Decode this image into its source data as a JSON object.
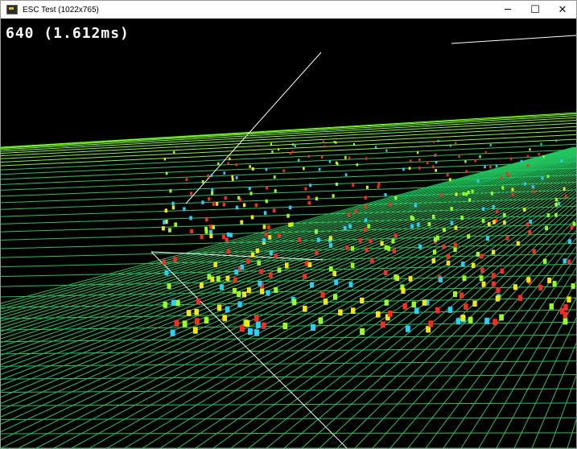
{
  "window": {
    "title": "ESC Test (1022x765)",
    "app_icon": "app-icon",
    "controls": {
      "minimize": "─",
      "maximize": "☐",
      "close": "✕"
    }
  },
  "hud": {
    "text": "640 (1.612ms)"
  },
  "scene": {
    "background": "#000000",
    "grid_color": "#22c55e",
    "bright_grid_color": "#7dff2f",
    "line_color": "#ffffff",
    "cube_colors": [
      "#ff2a1a",
      "#21d4ff",
      "#ffe600",
      "#9aff1a"
    ]
  }
}
